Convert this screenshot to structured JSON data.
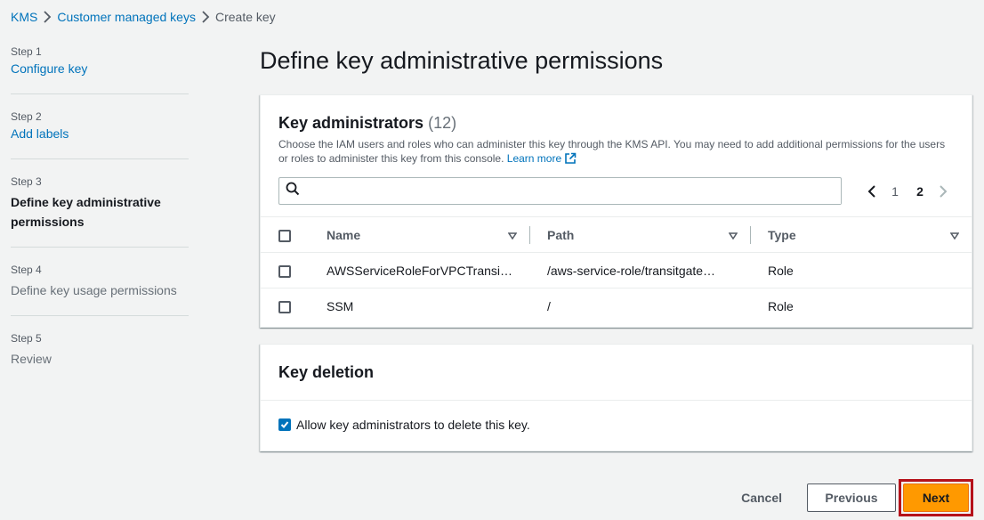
{
  "breadcrumb": {
    "items": [
      "KMS",
      "Customer managed keys"
    ],
    "current": "Create key"
  },
  "steps": [
    {
      "number": "Step 1",
      "title": "Configure key",
      "state": "link"
    },
    {
      "number": "Step 2",
      "title": "Add labels",
      "state": "link"
    },
    {
      "number": "Step 3",
      "title": "Define key administrative permissions",
      "state": "active"
    },
    {
      "number": "Step 4",
      "title": "Define key usage permissions",
      "state": "disabled"
    },
    {
      "number": "Step 5",
      "title": "Review",
      "state": "disabled"
    }
  ],
  "page": {
    "title": "Define key administrative permissions"
  },
  "admins": {
    "title": "Key administrators",
    "count": "(12)",
    "description": "Choose the IAM users and roles who can administer this key through the KMS API. You may need to add additional permissions for the users or roles to administer this key from this console.",
    "learn_more": "Learn more",
    "search_placeholder": "",
    "pagination": {
      "pages": [
        "1",
        "2"
      ],
      "current": "2"
    },
    "columns": [
      "Name",
      "Path",
      "Type"
    ],
    "rows": [
      {
        "name": "AWSServiceRoleForVPCTransit…",
        "path": "/aws-service-role/transitgate…",
        "type": "Role",
        "checked": false
      },
      {
        "name": "SSM",
        "path": "/",
        "type": "Role",
        "checked": false
      }
    ]
  },
  "deletion": {
    "title": "Key deletion",
    "checkbox_label": "Allow key administrators to delete this key.",
    "checked": true
  },
  "actions": {
    "cancel": "Cancel",
    "previous": "Previous",
    "next": "Next"
  },
  "colors": {
    "link": "#0073bb",
    "primary": "#ff9900",
    "highlight": "#b5121b"
  }
}
